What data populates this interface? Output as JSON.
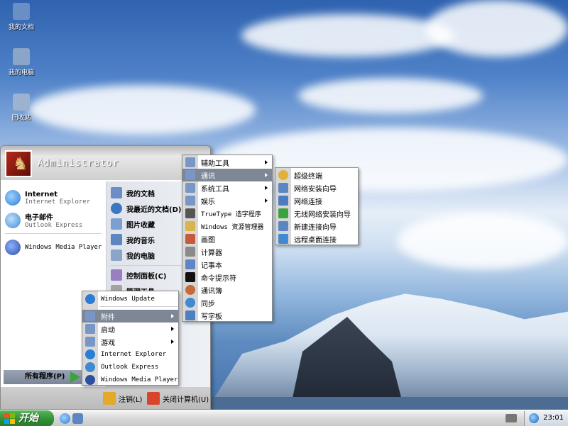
{
  "desktop_icons": [
    {
      "label": "我的文档",
      "color": "#6b8fc4"
    },
    {
      "label": "我的电脑",
      "color": "#8aa5c8"
    },
    {
      "label": "回收站",
      "color": "#9bb3d1"
    }
  ],
  "start_menu": {
    "user": "Administrator",
    "pinned": [
      {
        "title": "Internet",
        "subtitle": "Internet Explorer",
        "color": "#2a7fd4"
      },
      {
        "title": "电子邮件",
        "subtitle": "Outlook Express",
        "color": "#3f8ad0"
      }
    ],
    "recent": [
      {
        "title": "Windows Media Player",
        "color": "#2c4fa0"
      }
    ],
    "right_items": [
      {
        "label": "我的文档",
        "color": "#6b8fc4"
      },
      {
        "label": "我最近的文档(D)",
        "color": "#3c76c0"
      },
      {
        "label": "图片收藏",
        "color": "#7b9fd0"
      },
      {
        "label": "我的音乐",
        "color": "#5c86c2"
      },
      {
        "label": "我的电脑",
        "color": "#8aa5c8"
      },
      {
        "label": "控制面板(C)",
        "color": "#9a7ec2"
      },
      {
        "label": "管理工具",
        "color": "#a3a3a3"
      }
    ],
    "all_programs": "所有程序(P)",
    "logoff": "注销(L)",
    "shutdown": "关闭计算机(U)"
  },
  "programs_menu": [
    {
      "label": "Windows Update",
      "color": "#2d7bd2",
      "mono": true,
      "submenu": false
    },
    {
      "label": "附件",
      "color": "#7897c6",
      "submenu": true,
      "active": true
    },
    {
      "label": "启动",
      "color": "#7897c6",
      "submenu": true
    },
    {
      "label": "游戏",
      "color": "#7897c6",
      "submenu": true
    },
    {
      "label": "Internet Explorer",
      "color": "#2a7fd4",
      "mono": true,
      "submenu": false
    },
    {
      "label": "Outlook Express",
      "color": "#3f8ad0",
      "mono": true,
      "submenu": false
    },
    {
      "label": "Windows Media Player",
      "color": "#2c4fa0",
      "mono": true,
      "submenu": false
    }
  ],
  "accessories_menu": [
    {
      "label": "辅助工具",
      "color": "#7897c6",
      "submenu": true
    },
    {
      "label": "通讯",
      "color": "#7897c6",
      "submenu": true,
      "active": true
    },
    {
      "label": "系统工具",
      "color": "#7897c6",
      "submenu": true
    },
    {
      "label": "娱乐",
      "color": "#7897c6",
      "submenu": true
    },
    {
      "label": "TrueType 造字程序",
      "color": "#555555"
    },
    {
      "label": "Windows 资源管理器",
      "color": "#d9b44a"
    },
    {
      "label": "画图",
      "color": "#c65a3c"
    },
    {
      "label": "计算器",
      "color": "#8a8a8a"
    },
    {
      "label": "记事本",
      "color": "#5f86c4"
    },
    {
      "label": "命令提示符",
      "color": "#111111"
    },
    {
      "label": "通讯簿",
      "color": "#c46b3a"
    },
    {
      "label": "同步",
      "color": "#3f8ad0"
    },
    {
      "label": "写字板",
      "color": "#4f7fbe"
    }
  ],
  "communications_menu": [
    {
      "label": "超级终端",
      "color": "#e0b23a"
    },
    {
      "label": "网络安装向导",
      "color": "#5c86c2"
    },
    {
      "label": "网络连接",
      "color": "#4c7cc0"
    },
    {
      "label": "无线网络安装向导",
      "color": "#3aa23f"
    },
    {
      "label": "新建连接向导",
      "color": "#5c86c2"
    },
    {
      "label": "远程桌面连接",
      "color": "#3f8ad0"
    }
  ],
  "taskbar": {
    "start_label": "开始",
    "clock": "23:01"
  }
}
